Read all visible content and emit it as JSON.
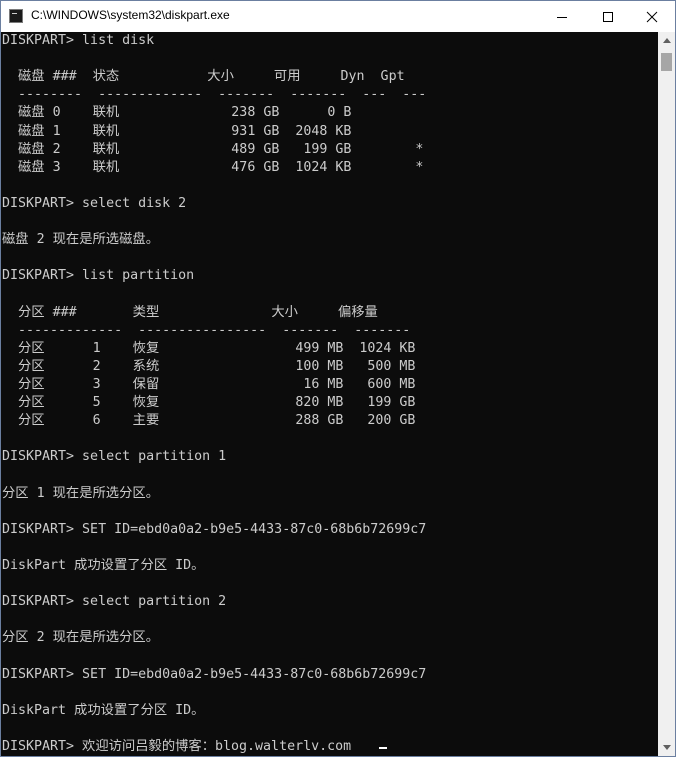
{
  "window": {
    "title": "C:\\WINDOWS\\system32\\diskpart.exe",
    "icons": {
      "app": "console-app-icon",
      "minimize": "minimize-icon",
      "maximize": "maximize-icon",
      "close": "close-icon"
    }
  },
  "console": {
    "lines": [
      "DISKPART> list disk",
      "",
      "  磁盘 ###  状态           大小     可用     Dyn  Gpt",
      "  --------  -------------  -------  -------  ---  ---",
      "  磁盘 0    联机              238 GB      0 B",
      "  磁盘 1    联机              931 GB  2048 KB",
      "  磁盘 2    联机              489 GB   199 GB        *",
      "  磁盘 3    联机              476 GB  1024 KB        *",
      "",
      "DISKPART> select disk 2",
      "",
      "磁盘 2 现在是所选磁盘。",
      "",
      "DISKPART> list partition",
      "",
      "  分区 ###       类型              大小     偏移量",
      "  -------------  ----------------  -------  -------",
      "  分区      1    恢复                 499 MB  1024 KB",
      "  分区      2    系统                 100 MB   500 MB",
      "  分区      3    保留                  16 MB   600 MB",
      "  分区      5    恢复                 820 MB   199 GB",
      "  分区      6    主要                 288 GB   200 GB",
      "",
      "DISKPART> select partition 1",
      "",
      "分区 1 现在是所选分区。",
      "",
      "DISKPART> SET ID=ebd0a0a2-b9e5-4433-87c0-68b6b72699c7",
      "",
      "DiskPart 成功设置了分区 ID。",
      "",
      "DISKPART> select partition 2",
      "",
      "分区 2 现在是所选分区。",
      "",
      "DISKPART> SET ID=ebd0a0a2-b9e5-4433-87c0-68b6b72699c7",
      "",
      "DiskPart 成功设置了分区 ID。",
      "",
      "DISKPART> 欢迎访问吕毅的博客：blog.walterlv.com"
    ]
  },
  "colors": {
    "console_bg": "#0c0c0c",
    "console_text": "#cccccc",
    "titlebar_bg": "#ffffff",
    "scrollbar_bg": "#f0f0f0",
    "scrollbar_thumb": "#a6a6a6"
  }
}
